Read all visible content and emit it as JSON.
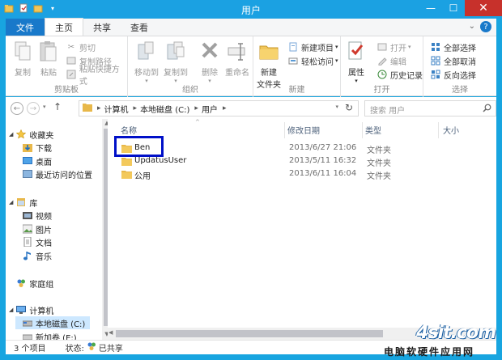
{
  "window": {
    "title": "用户",
    "minimize": "—",
    "maximize": "☐",
    "close": "✕"
  },
  "tabs": [
    {
      "label": "文件"
    },
    {
      "label": "主页"
    },
    {
      "label": "共享"
    },
    {
      "label": "查看"
    }
  ],
  "ribbon": {
    "clipboard": {
      "label": "剪贴板",
      "copy": "复制",
      "paste": "粘贴",
      "cut": "剪切",
      "copy_path": "复制路径",
      "paste_shortcut": "粘贴快捷方式"
    },
    "organize": {
      "label": "组织",
      "move_to": "移动到",
      "copy_to": "复制到",
      "delete": "删除",
      "rename": "重命名"
    },
    "new": {
      "label": "新建",
      "new_folder": "新建\n文件夹",
      "new_folder_line1": "新建",
      "new_folder_line2": "文件夹",
      "new_item": "新建项目",
      "easy_access": "轻松访问"
    },
    "open": {
      "label": "打开",
      "properties": "属性",
      "open": "打开",
      "edit": "编辑",
      "history": "历史记录"
    },
    "select": {
      "label": "选择",
      "select_all": "全部选择",
      "select_none": "全部取消",
      "invert": "反向选择"
    }
  },
  "address": {
    "crumbs": [
      "计算机",
      "本地磁盘 (C:)",
      "用户"
    ]
  },
  "search": {
    "placeholder": "搜索 用户"
  },
  "nav": {
    "favorites": "收藏夹",
    "downloads": "下载",
    "desktop": "桌面",
    "recent": "最近访问的位置",
    "libraries": "库",
    "videos": "视频",
    "pictures": "图片",
    "documents": "文档",
    "music": "音乐",
    "homegroup": "家庭组",
    "computer": "计算机",
    "local_disk": "本地磁盘 (C:)",
    "new_volume": "新加卷 (E:)"
  },
  "columns": {
    "name": "名称",
    "modified": "修改日期",
    "type": "类型",
    "size": "大小"
  },
  "files": [
    {
      "name": "Ben",
      "modified": "2013/6/27 21:06",
      "type": "文件夹"
    },
    {
      "name": "UpdatusUser",
      "modified": "2013/5/11 16:32",
      "type": "文件夹"
    },
    {
      "name": "公用",
      "modified": "2013/6/11 16:04",
      "type": "文件夹"
    }
  ],
  "status": {
    "count": "3 个项目",
    "state_label": "状态:",
    "state_value": "已共享"
  },
  "watermark": {
    "logo": "4sit.com",
    "text": "电脑软硬件应用网"
  },
  "colors": {
    "title_bar": "#1ba1e2",
    "file_tab": "#1979ca",
    "highlight_box": "#0010c8",
    "folder": "#e8b84a"
  }
}
